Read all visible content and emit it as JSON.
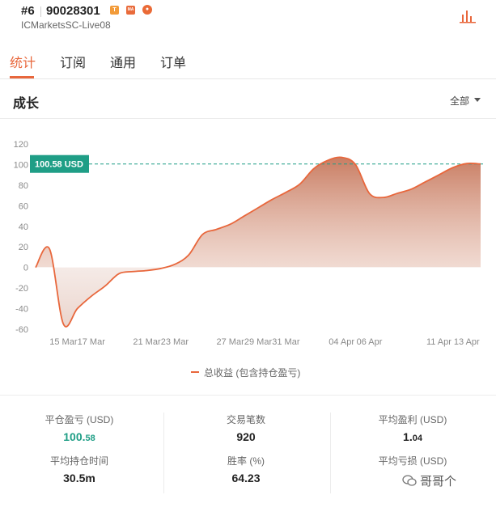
{
  "header": {
    "rank": "#6",
    "account_number": "90028301",
    "server": "ICMarketsSC-Live08",
    "badges": [
      "T",
      "MA",
      "fire-icon"
    ]
  },
  "tabs": [
    {
      "label": "统计",
      "active": true
    },
    {
      "label": "订阅",
      "active": false
    },
    {
      "label": "通用",
      "active": false
    },
    {
      "label": "订单",
      "active": false
    }
  ],
  "growth": {
    "title": "成长",
    "filter_label": "全部",
    "current_marker": "100.58 USD",
    "legend_label": "总收益 (包含持仓盈亏)"
  },
  "chart_data": {
    "type": "area",
    "series": [
      {
        "name": "总收益 (包含持仓盈亏)",
        "x": [
          "13 Mar",
          "14 Mar",
          "15 Mar",
          "16 Mar",
          "17 Mar",
          "18 Mar",
          "19 Mar",
          "20 Mar",
          "21 Mar",
          "22 Mar",
          "23 Mar",
          "24 Mar",
          "25 Mar",
          "26 Mar",
          "27 Mar",
          "28 Mar",
          "29 Mar",
          "30 Mar",
          "31 Mar",
          "01 Apr",
          "02 Apr",
          "03 Apr",
          "04 Apr",
          "05 Apr",
          "06 Apr",
          "07 Apr",
          "08 Apr",
          "09 Apr",
          "10 Apr",
          "11 Apr",
          "12 Apr",
          "13 Apr",
          "14 Apr"
        ],
        "values": [
          0,
          18,
          -55,
          -40,
          -28,
          -18,
          -6,
          -4,
          -3,
          -1,
          3,
          12,
          32,
          37,
          42,
          50,
          58,
          66,
          73,
          81,
          96,
          104,
          107,
          100,
          72,
          68,
          72,
          76,
          83,
          90,
          97,
          101,
          100.58
        ]
      }
    ],
    "ylim": [
      -60,
      120
    ],
    "yticks": [
      120,
      100,
      80,
      60,
      40,
      20,
      0,
      -20,
      -40,
      -60
    ],
    "xticks": [
      "15 Mar",
      "17 Mar",
      "21 Mar",
      "23 Mar",
      "27 Mar",
      "29 Mar",
      "31 Mar",
      "04 Apr",
      "06 Apr",
      "11 Apr",
      "13 Apr"
    ],
    "reference_line": 100.58,
    "colors": {
      "line": "#e8673c",
      "marker": "#1f9e86"
    },
    "grid": false,
    "legend": "bottom-center"
  },
  "stats": {
    "closed_pl_label": "平仓盈亏 (USD)",
    "closed_pl_int": "100.",
    "closed_pl_dec": "58",
    "trades_label": "交易笔数",
    "trades_value": "920",
    "avg_profit_label": "平均盈利 (USD)",
    "avg_profit_int": "1.",
    "avg_profit_dec": "04",
    "avg_hold_label": "平均持仓时间",
    "avg_hold_value": "30.5m",
    "win_rate_label": "胜率 (%)",
    "win_rate_value": "64.23",
    "avg_loss_label": "平均亏损 (USD)"
  },
  "watermark": "哥哥个",
  "colors": {
    "accent": "#e8673c",
    "positive": "#1f9e86"
  }
}
